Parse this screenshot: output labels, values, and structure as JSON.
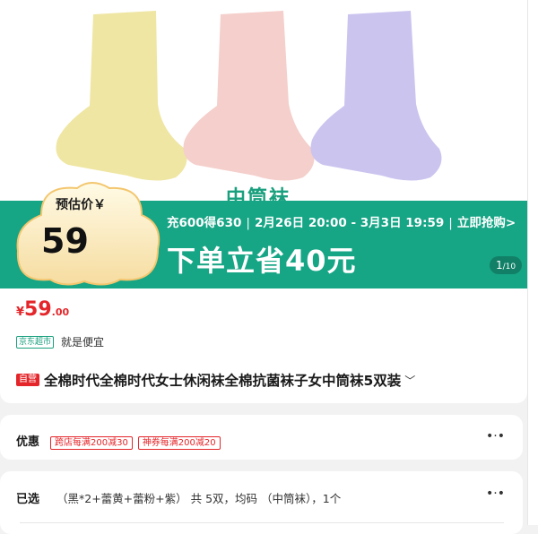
{
  "hero": {
    "sock_label": "中筒袜",
    "socks": [
      {
        "color": "#efe6a3"
      },
      {
        "color": "#f4cfcb"
      },
      {
        "color": "#cbc4ef"
      }
    ],
    "banner_color": "#16a585",
    "promo_line": {
      "part1": "充600得630",
      "part2": "2月26日 20:00 - 3月3日 19:59",
      "part3": "立即抢购>"
    },
    "promo_big": "下单立省40元",
    "estimate_label": "预估价￥",
    "estimate_value": "59",
    "counter_current": "1",
    "counter_total": "/10"
  },
  "product": {
    "price_symbol": "¥",
    "price_int": "59",
    "price_dec": ".00",
    "store_badge": "京东超市",
    "store_slogan": "就是便宜",
    "self_badge": "自营",
    "title": "全棉时代全棉时代女士休闲袜全棉抗菌袜子女中筒袜5双装"
  },
  "promotions": {
    "label": "优惠",
    "coupons": [
      "跨店每满200减30",
      "神券每满200减20"
    ]
  },
  "selection": {
    "label": "已选",
    "text": "（黑*2+蕾黄+蕾粉+紫） 共 5双，均码 （中筒袜），1个"
  }
}
